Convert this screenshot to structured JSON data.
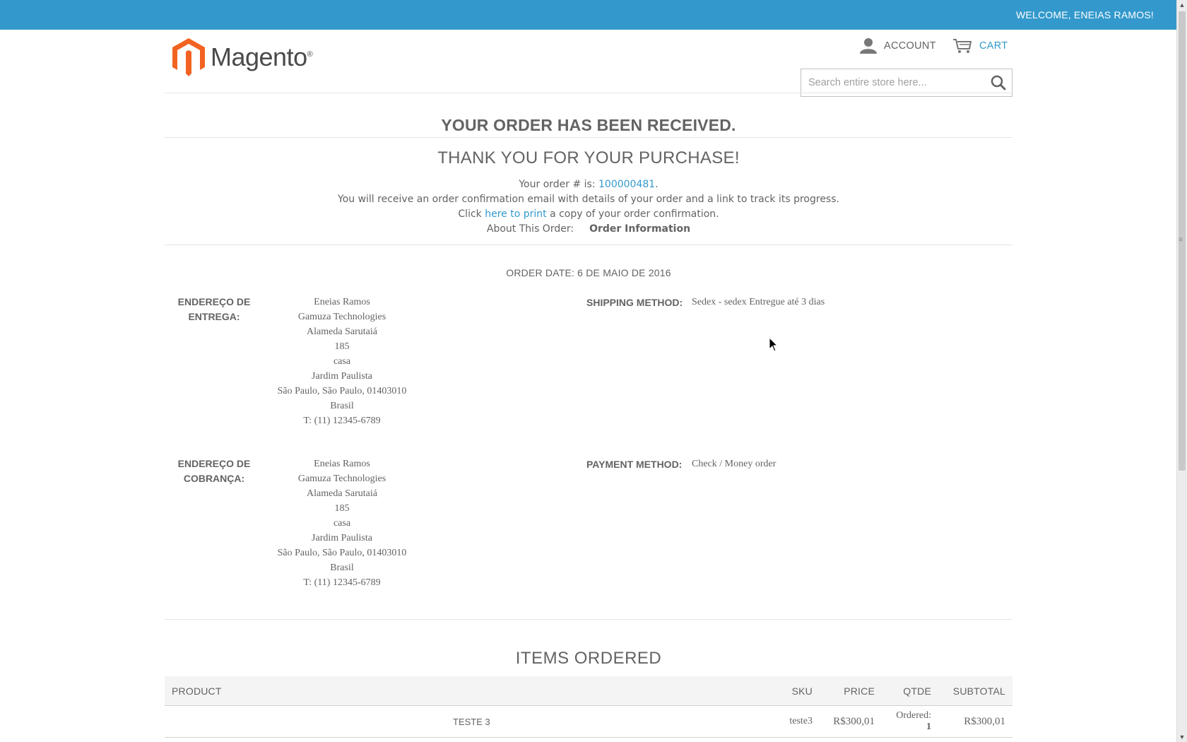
{
  "topbar": {
    "welcome": "WELCOME, ENEIAS RAMOS!"
  },
  "header": {
    "logo_text": "Magento",
    "logo_reg": "®",
    "account_label": "ACCOUNT",
    "cart_label": "CART",
    "search_placeholder": "Search entire store here..."
  },
  "colors": {
    "accent": "#3399cc",
    "logo_orange": "#f26322",
    "text": "#636363"
  },
  "main": {
    "title": "YOUR ORDER HAS BEEN RECEIVED.",
    "subtitle": "THANK YOU FOR YOUR PURCHASE!",
    "order_number_prefix": "Your order # is: ",
    "order_number": "100000481",
    "order_number_suffix": ".",
    "confirmation_text": "You will receive an order confirmation email with details of your order and a link to track its progress.",
    "print_prefix": "Click ",
    "print_link": "here to print",
    "print_suffix": " a copy of your order confirmation.",
    "about_label": "About This Order:",
    "about_value": "Order Information",
    "order_date": "ORDER DATE: 6 DE MAIO DE 2016"
  },
  "shipping_address": {
    "label_line1": "ENDEREÇO DE",
    "label_line2": "ENTREGA:",
    "lines": [
      "Eneias Ramos",
      "Gamuza Technologies",
      "Alameda Sarutaiá",
      "185",
      "casa",
      "Jardim Paulista",
      "São Paulo, São Paulo, 01403010",
      "Brasil",
      "T: (11) 12345-6789"
    ]
  },
  "billing_address": {
    "label_line1": "ENDEREÇO DE",
    "label_line2": "COBRANÇA:",
    "lines": [
      "Eneias Ramos",
      "Gamuza Technologies",
      "Alameda Sarutaiá",
      "185",
      "casa",
      "Jardim Paulista",
      "São Paulo, São Paulo, 01403010",
      "Brasil",
      "T: (11) 12345-6789"
    ]
  },
  "shipping_method": {
    "label": "SHIPPING METHOD:",
    "value": "Sedex - sedex Entregue até 3 dias"
  },
  "payment_method": {
    "label": "PAYMENT METHOD:",
    "value": "Check / Money order"
  },
  "items": {
    "title": "ITEMS ORDERED",
    "headers": [
      "PRODUCT",
      "SKU",
      "PRICE",
      "QTDE",
      "SUBTOTAL"
    ],
    "rows": [
      {
        "product": "TESTE 3",
        "sku": "teste3",
        "price": "R$300,01",
        "qty_label": "Ordered:",
        "qty": "1",
        "subtotal": "R$300,01"
      }
    ]
  }
}
